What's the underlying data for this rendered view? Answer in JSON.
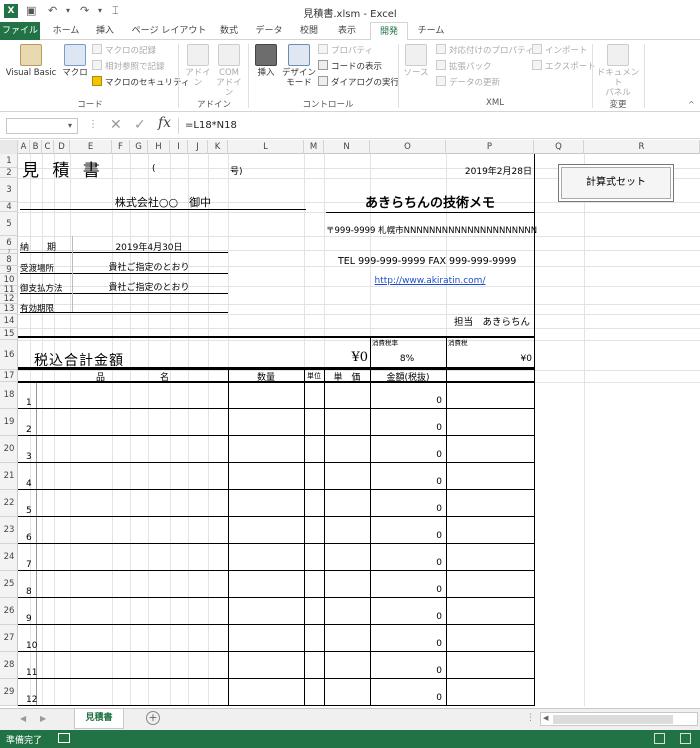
{
  "window": {
    "title": "見積書.xlsm - Excel",
    "app_icon": "X"
  },
  "tabs": [
    "ファイル",
    "ホーム",
    "挿入",
    "ページ レイアウト",
    "数式",
    "データ",
    "校閲",
    "表示",
    "開発",
    "チーム"
  ],
  "active_tab": "開発",
  "ribbon": {
    "code": {
      "group": "コード",
      "visual_basic": "Visual Basic",
      "macro": "マクロ",
      "record_macro": "マクロの記録",
      "relative_ref": "相対参照で記録",
      "macro_security": "マクロのセキュリティ"
    },
    "addin": {
      "group": "アドイン",
      "addin": "アドイン",
      "com_addin_1": "COM",
      "com_addin_2": "アドイン"
    },
    "controls": {
      "group": "コントロール",
      "insert": "挿入",
      "design_mode_1": "デザイン",
      "design_mode_2": "モード",
      "properties": "プロパティ",
      "view_code": "コードの表示",
      "run_dialog": "ダイアログの実行"
    },
    "xml": {
      "group": "XML",
      "source": "ソース",
      "map_properties": "対応付けのプロパティ",
      "expansion_packs": "拡張パック",
      "refresh_data": "データの更新",
      "import": "インポート",
      "export": "エクスポート"
    },
    "modify": {
      "group": "変更",
      "doc_panel_1": "ドキュメント",
      "doc_panel_2": "パネル"
    }
  },
  "formula_bar": {
    "name_box": "",
    "formula": "=L18*N18"
  },
  "columns": [
    "A",
    "B",
    "C",
    "D",
    "E",
    "F",
    "G",
    "H",
    "I",
    "J",
    "K",
    "L",
    "M",
    "N",
    "O",
    "P",
    "Q",
    "R"
  ],
  "row_numbers": [
    "1",
    "2",
    "3",
    "4",
    "5",
    "6",
    "7",
    "8",
    "9",
    "10",
    "11",
    "12",
    "13",
    "14",
    "15",
    "16",
    "17",
    "18",
    "19",
    "20",
    "21",
    "22",
    "23",
    "24",
    "25",
    "26",
    "27",
    "28",
    "29"
  ],
  "sheet": {
    "title": "見 積 書",
    "paren_open": "(",
    "number_suffix": "号)",
    "date": "2019年2月28日",
    "client": "株式会社○○　御中",
    "company": "あきらちんの技術メモ",
    "address": "〒999-9999 札幌市NNNNNNNNNNNNNNNNNNNNN",
    "tel_fax": "TEL  999-999-9999  FAX  999-999-9999",
    "url": "http://www.akiratin.com/",
    "contact": "担当　あきらちん",
    "fields": [
      {
        "label": "納　　期",
        "value": "2019年4月30日"
      },
      {
        "label": "受渡場所",
        "value": "貴社ご指定のとおり"
      },
      {
        "label": "御支払方法",
        "value": "貴社ご指定のとおり"
      },
      {
        "label": "有効期限",
        "value": ""
      }
    ],
    "tax_rate_label": "消費税率",
    "tax_label": "消費税",
    "total_label": "税込合計金額",
    "total_value": "¥0",
    "tax_rate": "8%",
    "tax_value": "¥0",
    "headers": {
      "name_1": "品",
      "name_2": "名",
      "qty": "数量",
      "unit": "単位",
      "price": "単　価",
      "amount": "金額(税抜)"
    },
    "items": [
      {
        "no": "1",
        "amount": "0"
      },
      {
        "no": "2",
        "amount": "0"
      },
      {
        "no": "3",
        "amount": "0"
      },
      {
        "no": "4",
        "amount": "0"
      },
      {
        "no": "5",
        "amount": "0"
      },
      {
        "no": "6",
        "amount": "0"
      },
      {
        "no": "7",
        "amount": "0"
      },
      {
        "no": "8",
        "amount": "0"
      },
      {
        "no": "9",
        "amount": "0"
      },
      {
        "no": "10",
        "amount": "0"
      },
      {
        "no": "11",
        "amount": "0"
      },
      {
        "no": "12",
        "amount": "0"
      }
    ]
  },
  "button_calc": "計算式セット",
  "sheet_tab": "見積書",
  "status": "準備完了",
  "colors": {
    "excel_green": "#217346"
  }
}
